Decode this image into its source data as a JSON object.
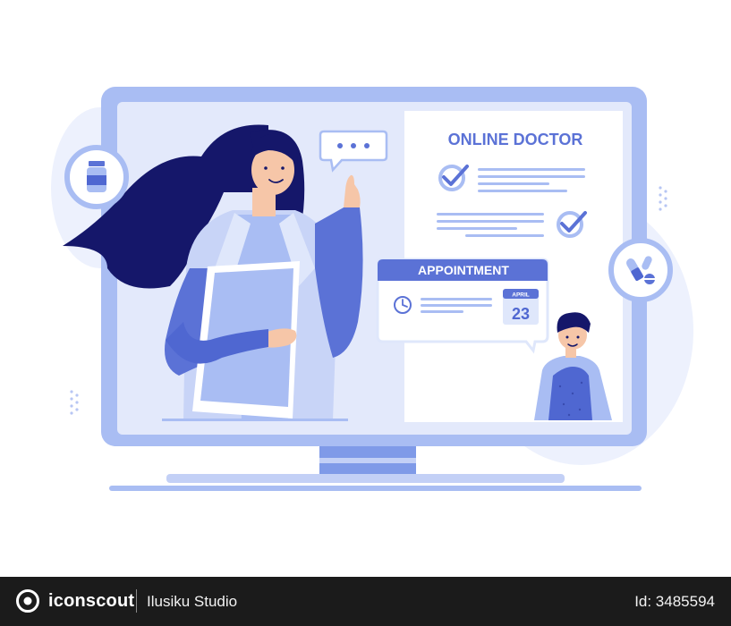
{
  "illustration": {
    "header_title": "ONLINE DOCTOR",
    "appointment_label": "APPOINTMENT",
    "calendar_month": "APRIL",
    "calendar_day": "23",
    "colors": {
      "primary_blue": "#5b72d6",
      "light_blue": "#dfe7fb",
      "frame_blue": "#a9bdf3",
      "hair": "#15176a"
    }
  },
  "footer": {
    "brand_name": "iconscout",
    "author": "Ilusiku Studio",
    "asset_id": "Id: 3485594"
  }
}
